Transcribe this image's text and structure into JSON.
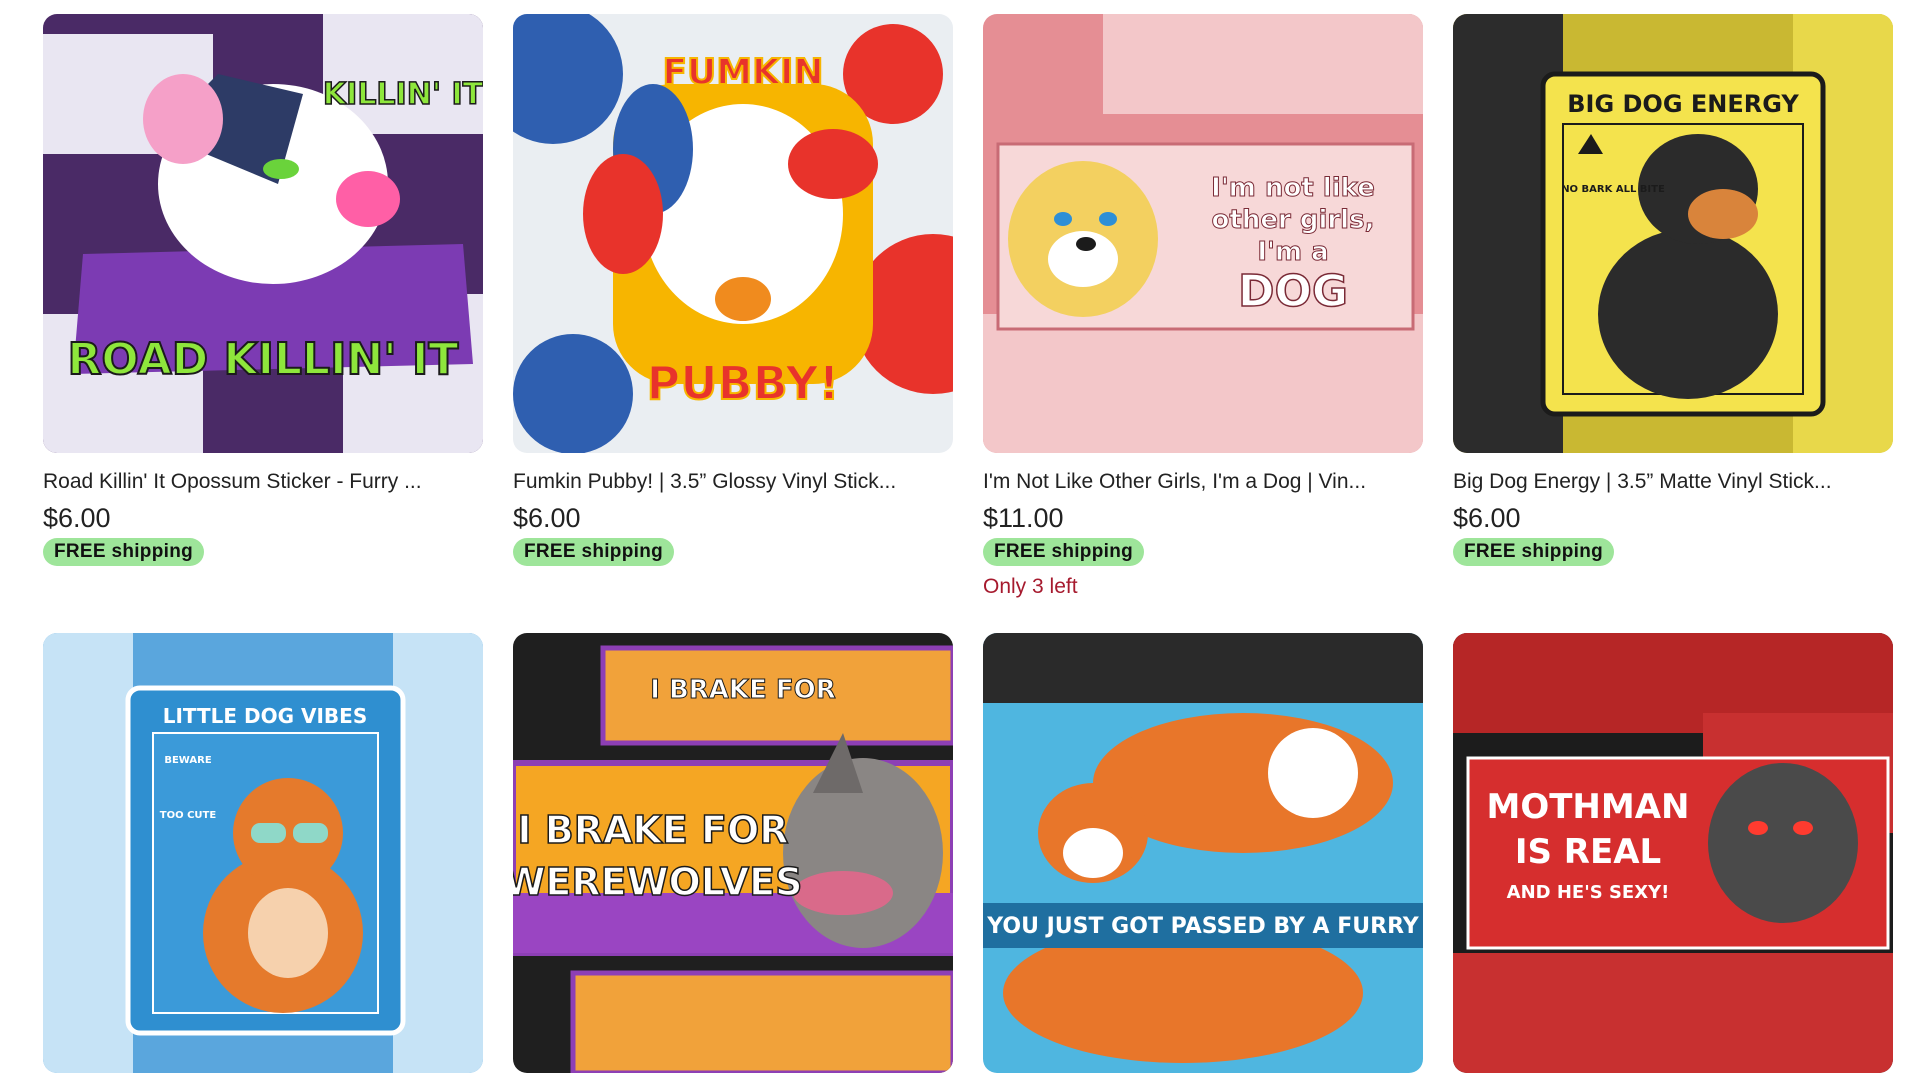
{
  "listings": [
    {
      "title": "Road Killin' It Opossum Sticker - Furry ...",
      "price": "$6.00",
      "shipping": "FREE shipping",
      "image_text": [
        "ROAD KILLIN' IT",
        "KILLIN' IT"
      ],
      "image_colors": {
        "bg": "#6a2c8f",
        "accent": "#7ed321"
      }
    },
    {
      "title": "Fumkin Pubby! | 3.5” Glossy Vinyl Stick...",
      "price": "$6.00",
      "shipping": "FREE shipping",
      "image_text": [
        "FUMKIN",
        "PUBBY!"
      ],
      "image_colors": {
        "bg": "#f2f2f2",
        "accent": "#f5b400"
      }
    },
    {
      "title": "I'm Not Like Other Girls, I'm a Dog | Vin...",
      "price": "$11.00",
      "shipping": "FREE shipping",
      "stock": "Only 3 left",
      "image_text": [
        "I'm not like",
        "other girls,",
        "I'm a",
        "DOG"
      ],
      "image_colors": {
        "bg": "#e78f95",
        "accent": "#f3d060"
      }
    },
    {
      "title": "Big Dog Energy | 3.5” Matte Vinyl Stick...",
      "price": "$6.00",
      "shipping": "FREE shipping",
      "image_text": [
        "BIG DOG ENERGY",
        "NO BARK ALL BITE"
      ],
      "image_colors": {
        "bg": "#f1e14a",
        "accent": "#2a2a2a"
      }
    },
    {
      "image_text": [
        "LITTLE DOG VIBES",
        "BEWARE",
        "TOO CUTE"
      ],
      "image_colors": {
        "bg": "#2f8fd0",
        "accent": "#e57a2c"
      }
    },
    {
      "image_text": [
        "I BRAKE FOR",
        "WEREWOLVES"
      ],
      "image_colors": {
        "bg": "#8d3fb5",
        "accent": "#f5a623"
      }
    },
    {
      "image_text": [
        "YOU JUST GOT PASSED BY A FURRY"
      ],
      "image_colors": {
        "bg": "#4fb6e0",
        "accent": "#e8762a"
      }
    },
    {
      "image_text": [
        "MOTHMAN",
        "IS REAL",
        "AND HE'S SEXY!"
      ],
      "image_colors": {
        "bg": "#d62e2e",
        "accent": "#1c1c1c"
      }
    }
  ]
}
